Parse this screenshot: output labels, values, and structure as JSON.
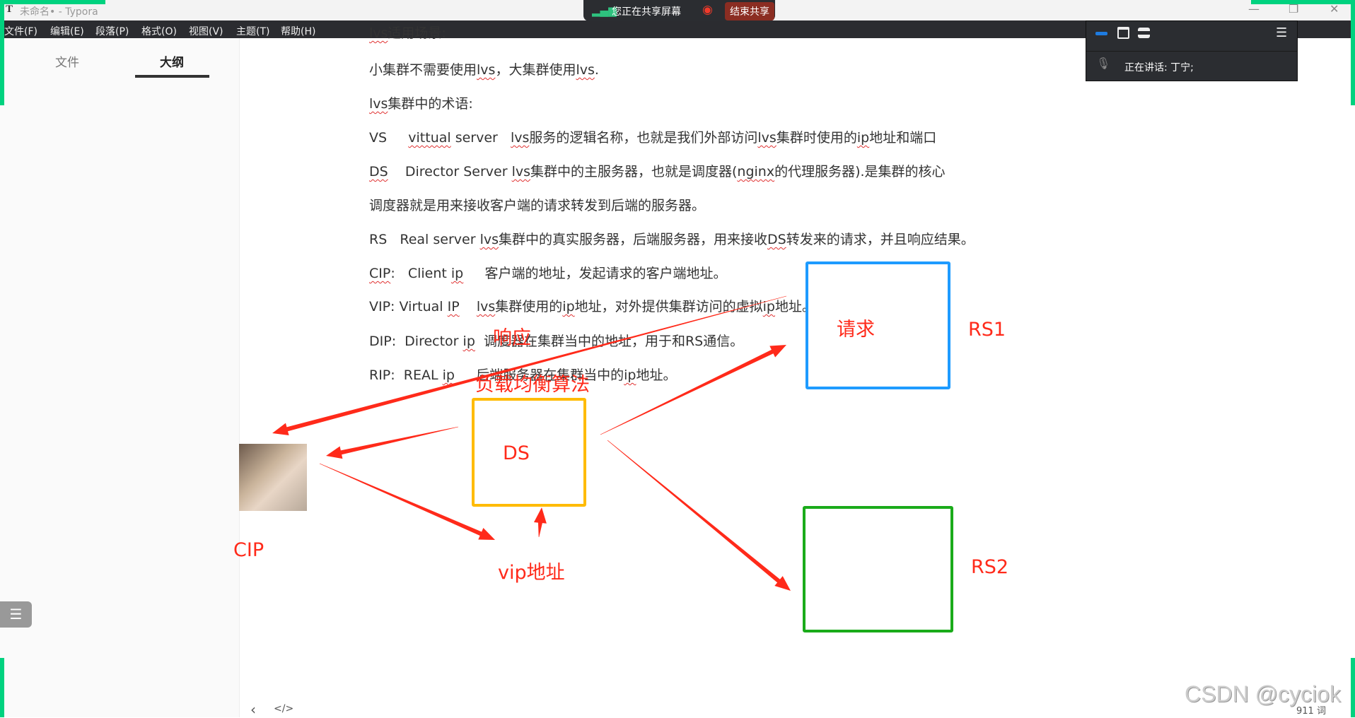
{
  "window": {
    "app_icon": "T",
    "title": "未命名• - Typora",
    "minimize": "—",
    "restore": "❐",
    "close": "✕"
  },
  "menu": [
    "文件(F)",
    "编辑(E)",
    "段落(P)",
    "格式(O)",
    "视图(V)",
    "主题(T)",
    "帮助(H)"
  ],
  "sidebar": {
    "tabs": [
      "文件",
      "大纲"
    ],
    "active_tab": "大纲",
    "outline_icon": "☰"
  },
  "share_bar": {
    "status": "您正在共享屏幕",
    "end_button": "结束共享"
  },
  "meeting_panel": {
    "speaking_label": "正在讲话:",
    "speaker": "丁宁;"
  },
  "document": {
    "lines": [
      [
        "lvs",
        "适用场景:"
      ],
      [
        "小集群不需要使用",
        "lvs",
        "，大集群使用",
        "lvs",
        "."
      ],
      [
        "lvs",
        "集群中的术语:"
      ],
      [
        "VS     ",
        "vittual",
        " server   ",
        "lvs",
        "服务的逻辑名称，也就是我们外部访问",
        "lvs",
        "集群时使用的",
        "ip",
        "地址和端口"
      ],
      [
        "DS",
        "    Director Server ",
        "lvs",
        "集群中的主服务器，也就是调度器(",
        "nginx",
        "的代理服务器).是集群的核心"
      ],
      [
        "调度器就是用来接收客户端的请求转发到后端的服务器。"
      ],
      [
        "RS   Real server ",
        "lvs",
        "集群中的真实服务器，后端服务器，用来接收",
        "DS",
        "转发来的请求，并且响应结果。"
      ],
      [
        "CIP",
        ":   Client ",
        "ip",
        "     客户端的地址，发起请求的客户端地址。"
      ],
      [
        "VIP: Virtual ",
        "IP",
        "    ",
        "lvs",
        "集群使用的",
        "ip",
        "地址，对外提供集群访问的虚拟",
        "ip",
        "地址。"
      ],
      [
        "DIP:  Director ",
        "ip",
        "  调度器在集群当中的地址，用于和RS通信。"
      ],
      [
        "RIP:  REAL ",
        "ip",
        "     后端服务器在集群当中的",
        "ip",
        "地址。"
      ]
    ],
    "spell_flagged": [
      "lvs",
      "vittual",
      "ip",
      "IP",
      "DS",
      "nginx",
      "CIP"
    ]
  },
  "diagram": {
    "labels": {
      "request": "请求",
      "rs1": "RS1",
      "rs2": "RS2",
      "ds": "DS",
      "cip": "CIP",
      "vip": "vip地址",
      "response": "响应",
      "lb": "负载均衡算法"
    },
    "colors": {
      "rs1": "#1e9bff",
      "rs2": "#1aab1a",
      "ds": "#ffbb00",
      "arrows": "#ff2a1a"
    }
  },
  "footer": {
    "back_icon": "‹",
    "source_icon": "</>",
    "word_count": "911 词"
  },
  "watermark": "CSDN @cyciok",
  "colors": {
    "share_border": "#00d27f",
    "menubar": "#2b2c30"
  }
}
